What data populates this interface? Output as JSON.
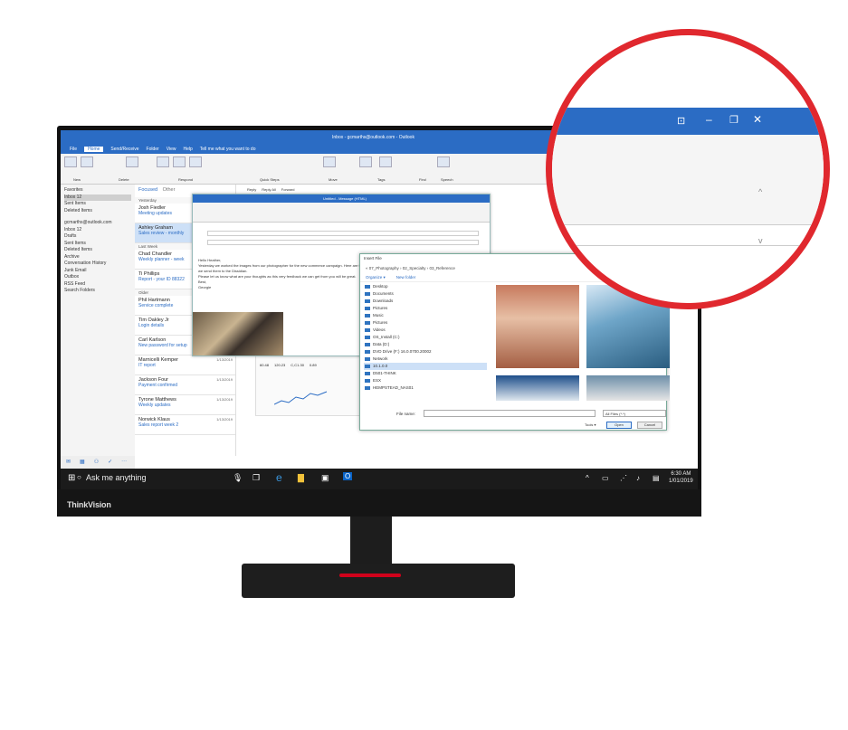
{
  "outlook": {
    "title": "Inbox - gcmarths@outlook.com - Outlook",
    "tabs": [
      "File",
      "Home",
      "Send/Receive",
      "Folder",
      "View",
      "Help",
      "Tell me what you want to do"
    ],
    "ribbon_groups": [
      "New",
      "Delete",
      "Respond",
      "Quick Steps",
      "Move",
      "Tags",
      "Find",
      "Speech"
    ],
    "folders": [
      "Favorites",
      "Inbox 12",
      "Sent Items",
      "Deleted Items",
      "gcmarths@outlook.com",
      "Inbox 12",
      "Drafts",
      "Sent Items",
      "Deleted Items",
      "Archive",
      "Conversation History",
      "Junk Email",
      "Outbox",
      "RSS Feed",
      "Search Folders"
    ],
    "list_tabs": [
      "Focused",
      "Other"
    ],
    "messages": [
      {
        "group": "Yesterday"
      },
      {
        "name": "Josh Fiedler",
        "subject": "Meeting updates",
        "date": ""
      },
      {
        "name": "Ashley Graham",
        "subject": "Sales review - monthly",
        "date": ""
      },
      {
        "group": "Last Week"
      },
      {
        "name": "Chad Chandler",
        "subject": "Weekly planner - week",
        "date": ""
      },
      {
        "name": "Ti Phillips",
        "subject": "Report - your ID 88322",
        "date": ""
      },
      {
        "group": "Older"
      },
      {
        "name": "Phil Hartmann",
        "subject": "Service complete",
        "date": ""
      },
      {
        "name": "Tim Oakley Jr",
        "subject": "Login details",
        "date": "1/13/2019"
      },
      {
        "name": "Carl Karlson",
        "subject": "New password for setup",
        "date": "1/13/2019"
      },
      {
        "name": "Marnicelli Kemper",
        "subject": "IT report",
        "date": "1/13/2019"
      },
      {
        "name": "Jackson Four",
        "subject": "Payment confirmed",
        "date": "1/13/2019"
      },
      {
        "name": "Tyrone Matthews",
        "subject": "Weekly updates",
        "date": "1/13/2019"
      },
      {
        "name": "Norwick Klaus",
        "subject": "Sales report week 2",
        "date": "1/13/2019"
      }
    ]
  },
  "reply": {
    "title": "Untitled - Message (HTML)",
    "actions": [
      "Reply",
      "Reply All",
      "Forward"
    ],
    "body": [
      "Hello Heather,",
      "Yesterday we worked the images from our photographer for the new commerce campaign. Here are the ones we like, take a look at them and help us make a selection before we send them to the Dissidian.",
      "Please let us know what are your thoughts as this very feedback we can get from you will be great.",
      "Best,",
      "Georgie"
    ]
  },
  "dialog": {
    "title": "Insert File",
    "path": "« 07_Photography › 02_Specialty › 03_Reference",
    "organize": "Organize ▾",
    "new_folder": "New folder",
    "tree": [
      "Desktop",
      "Documents",
      "Downloads",
      "Pictures",
      "Music",
      "Pictures",
      "Videos",
      "OS_Install (C:)",
      "Data (D:)",
      "DVD Drive (F:) 16.0.0700.20002",
      "Network",
      "10.1.0.0",
      "D501-THINK",
      "ESX",
      "HEMPSTEAD_NAS01"
    ],
    "file_name_label": "File name:",
    "file_type": "All Files (*.*)",
    "tools": "Tools ▾",
    "open": "Open",
    "cancel": "Cancel"
  },
  "sheet": {
    "values": [
      "60.48",
      "120.23",
      "C,C1.30",
      "0.89"
    ]
  },
  "taskbar": {
    "search": "Ask me anything",
    "time": "6:30 AM",
    "date": "1/01/2019"
  },
  "monitor": {
    "brand": "ThinkVision"
  },
  "lens": {
    "controls": [
      "⊡",
      "–",
      "❐",
      "✕"
    ],
    "arrows": [
      "^",
      "v"
    ]
  }
}
